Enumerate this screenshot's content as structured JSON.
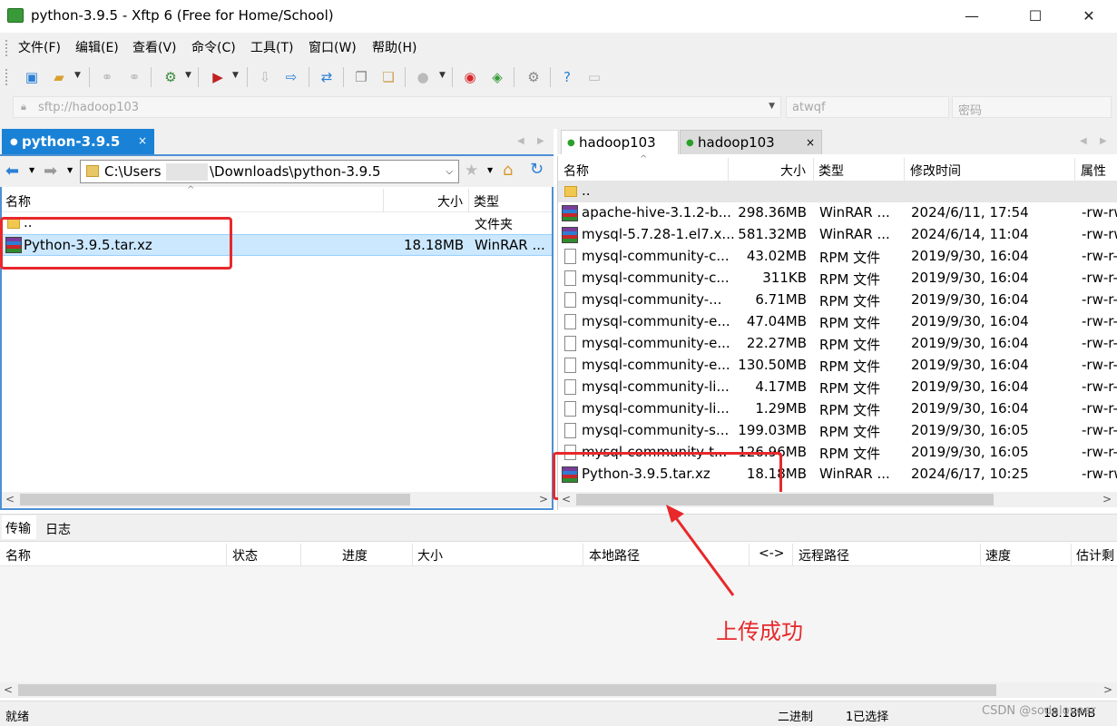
{
  "window": {
    "title": "python-3.9.5 - Xftp 6 (Free for Home/School)",
    "minimize": "—",
    "maximize": "☐",
    "close": "✕"
  },
  "menu": [
    "文件(F)",
    "编辑(E)",
    "查看(V)",
    "命令(C)",
    "工具(T)",
    "窗口(W)",
    "帮助(H)"
  ],
  "address": {
    "host_placeholder": "sftp://hadoop103",
    "user_placeholder": "atwqf",
    "password_placeholder": "密码"
  },
  "left": {
    "tab": "python-3.9.5",
    "tab_close": "×",
    "path_prefix": "C:\\Users",
    "path_suffix": "\\Downloads\\python-3.9.5",
    "columns": [
      "名称",
      "大小",
      "类型"
    ],
    "files": [
      {
        "name": "..",
        "size": "",
        "type": "文件夹",
        "icon": "folder-icon"
      },
      {
        "name": "Python-3.9.5.tar.xz",
        "size": "18.18MB",
        "type": "WinRAR ...",
        "icon": "winrar-icon"
      }
    ]
  },
  "right": {
    "tabs": [
      {
        "label": "hadoop103"
      },
      {
        "label": "hadoop103",
        "close": "×"
      }
    ],
    "columns": [
      "名称",
      "大小",
      "类型",
      "修改时间",
      "属性"
    ],
    "files": [
      {
        "name": "..",
        "size": "",
        "type": "",
        "modified": "",
        "attr": "",
        "icon": "folder-icon"
      },
      {
        "name": "apache-hive-3.1.2-b...",
        "size": "298.36MB",
        "type": "WinRAR ...",
        "modified": "2024/6/11, 17:54",
        "attr": "-rw-rw",
        "icon": "winrar-icon"
      },
      {
        "name": "mysql-5.7.28-1.el7.x...",
        "size": "581.32MB",
        "type": "WinRAR ...",
        "modified": "2024/6/14, 11:04",
        "attr": "-rw-rw",
        "icon": "winrar-icon"
      },
      {
        "name": "mysql-community-c...",
        "size": "43.02MB",
        "type": "RPM 文件",
        "modified": "2019/9/30, 16:04",
        "attr": "-rw-r-",
        "icon": "file-icon"
      },
      {
        "name": "mysql-community-c...",
        "size": "311KB",
        "type": "RPM 文件",
        "modified": "2019/9/30, 16:04",
        "attr": "-rw-r-",
        "icon": "file-icon"
      },
      {
        "name": "mysql-community-...",
        "size": "6.71MB",
        "type": "RPM 文件",
        "modified": "2019/9/30, 16:04",
        "attr": "-rw-r-",
        "icon": "file-icon"
      },
      {
        "name": "mysql-community-e...",
        "size": "47.04MB",
        "type": "RPM 文件",
        "modified": "2019/9/30, 16:04",
        "attr": "-rw-r-",
        "icon": "file-icon"
      },
      {
        "name": "mysql-community-e...",
        "size": "22.27MB",
        "type": "RPM 文件",
        "modified": "2019/9/30, 16:04",
        "attr": "-rw-r-",
        "icon": "file-icon"
      },
      {
        "name": "mysql-community-e...",
        "size": "130.50MB",
        "type": "RPM 文件",
        "modified": "2019/9/30, 16:04",
        "attr": "-rw-r-",
        "icon": "file-icon"
      },
      {
        "name": "mysql-community-li...",
        "size": "4.17MB",
        "type": "RPM 文件",
        "modified": "2019/9/30, 16:04",
        "attr": "-rw-r-",
        "icon": "file-icon"
      },
      {
        "name": "mysql-community-li...",
        "size": "1.29MB",
        "type": "RPM 文件",
        "modified": "2019/9/30, 16:04",
        "attr": "-rw-r-",
        "icon": "file-icon"
      },
      {
        "name": "mysql-community-s...",
        "size": "199.03MB",
        "type": "RPM 文件",
        "modified": "2019/9/30, 16:05",
        "attr": "-rw-r-",
        "icon": "file-icon"
      },
      {
        "name": "mysql-community-t...",
        "size": "126.96MB",
        "type": "RPM 文件",
        "modified": "2019/9/30, 16:05",
        "attr": "-rw-r-",
        "icon": "file-icon"
      },
      {
        "name": "Python-3.9.5.tar.xz",
        "size": "18.18MB",
        "type": "WinRAR ...",
        "modified": "2024/6/17, 10:25",
        "attr": "-rw-rw",
        "icon": "winrar-icon"
      }
    ]
  },
  "transfer": {
    "tabs": [
      "传输",
      "日志"
    ],
    "columns": [
      "名称",
      "状态",
      "进度",
      "大小",
      "本地路径",
      "<->",
      "远程路径",
      "速度",
      "估计剩"
    ]
  },
  "status": {
    "ready": "就绪",
    "mode": "二进制",
    "selection": "1已选择",
    "size": "18.18MB"
  },
  "annotation": "上传成功",
  "watermark": "CSDN @sodaloveer",
  "colors": {
    "accent": "#1a82d6",
    "highlight_box": "#e8282b",
    "selected_row": "#cce8ff",
    "online_dot": "#2aa02a"
  }
}
